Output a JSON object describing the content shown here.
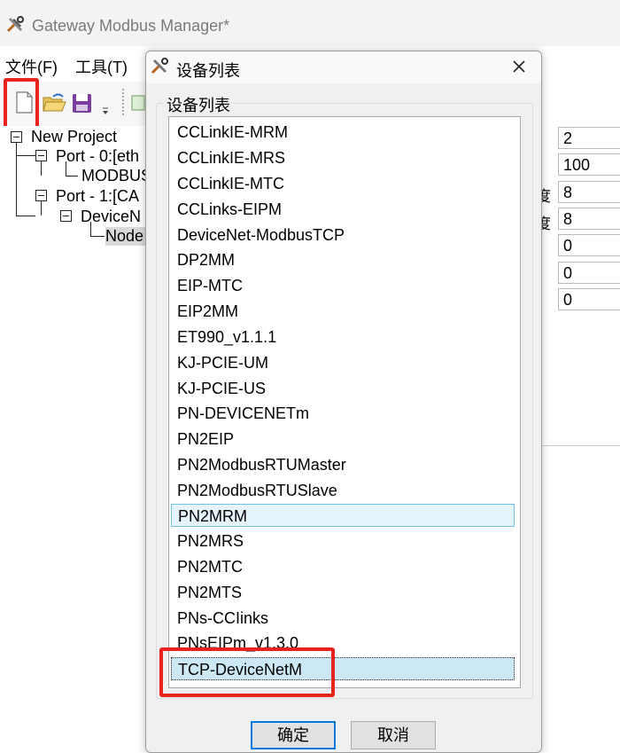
{
  "window": {
    "title": "Gateway Modbus Manager*"
  },
  "menu": {
    "file": "文件(F)",
    "tools": "工具(T)"
  },
  "toolbar": {
    "buttons": [
      {
        "icon": "new-document-icon"
      },
      {
        "icon": "open-folder-icon"
      },
      {
        "icon": "save-disk-icon"
      },
      {
        "icon": "chevron-down-icon"
      }
    ]
  },
  "tree": {
    "root": "New Project",
    "port0": "Port - 0:[eth",
    "modbus": "MODBUS",
    "port1": "Port - 1:[CA",
    "device": "DeviceN",
    "node": "Node"
  },
  "properties": {
    "rows": [
      {
        "label": "",
        "value": "2"
      },
      {
        "label": "",
        "value": "100"
      },
      {
        "label": "度",
        "value": "8"
      },
      {
        "label": "度",
        "value": "8"
      },
      {
        "label": "",
        "value": "0"
      },
      {
        "label": "",
        "value": "0"
      },
      {
        "label": "",
        "value": "0"
      }
    ]
  },
  "dialog": {
    "title": "设备列表",
    "group_label": "设备列表",
    "items": [
      "CCLinkIE-MRM",
      "CCLinkIE-MRS",
      "CCLinkIE-MTC",
      "CCLinks-EIPM",
      "DeviceNet-ModbusTCP",
      "DP2MM",
      "EIP-MTC",
      "EIP2MM",
      "ET990_v1.1.1",
      "KJ-PCIE-UM",
      "KJ-PCIE-US",
      "PN-DEVICENETm",
      "PN2EIP",
      "PN2ModbusRTUMaster",
      "PN2ModbusRTUSlave",
      "PN2MRM",
      "PN2MRS",
      "PN2MTC",
      "PN2MTS",
      "PNs-CCIinks",
      "PNsEIPm_v1.3.0",
      "TCP-DeviceNetM"
    ],
    "hover_item": "PN2MRM",
    "selected_item": "TCP-DeviceNetM",
    "ok_label": "确定",
    "cancel_label": "取消"
  },
  "colors": {
    "highlight_box": "#e8231e",
    "selection_fill": "#cce8f5",
    "hover_fill": "#e5f3fb",
    "hover_border": "#70c0e7"
  }
}
